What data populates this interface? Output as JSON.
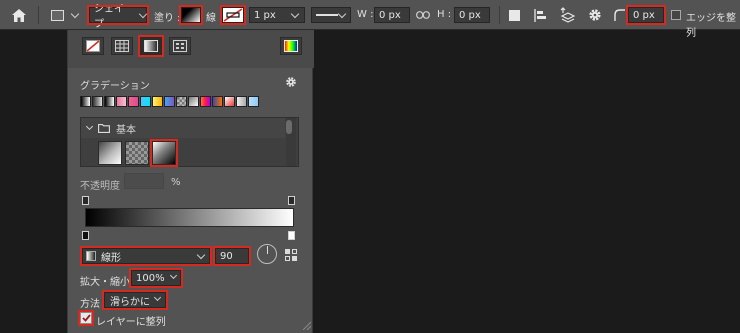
{
  "optionsbar": {
    "shape_mode": "シェイプ",
    "fill_label": "塗り :",
    "stroke_label": "線 :",
    "stroke_width": "1 px",
    "w_label": "W :",
    "w_value": "0 px",
    "h_label": "H :",
    "h_value": "0 px",
    "radius_value": "0 px",
    "align_edges_label": "エッジを整列"
  },
  "panel": {
    "gradient_title": "グラデーション",
    "folder_label": "基本",
    "opacity_label": "不透明度 :",
    "opacity_unit": "%",
    "gradient_type": "線形",
    "angle": "90",
    "scale_label": "拡大・縮小 :",
    "scale_value": "100%",
    "method_label": "方法 :",
    "method_value": "滑らかに",
    "align_layer_label": "レイヤーに整列"
  },
  "colors": {
    "accent_red": "#d42a20",
    "panel_bg": "#535353",
    "canvas_bg": "#1b1b1b"
  }
}
